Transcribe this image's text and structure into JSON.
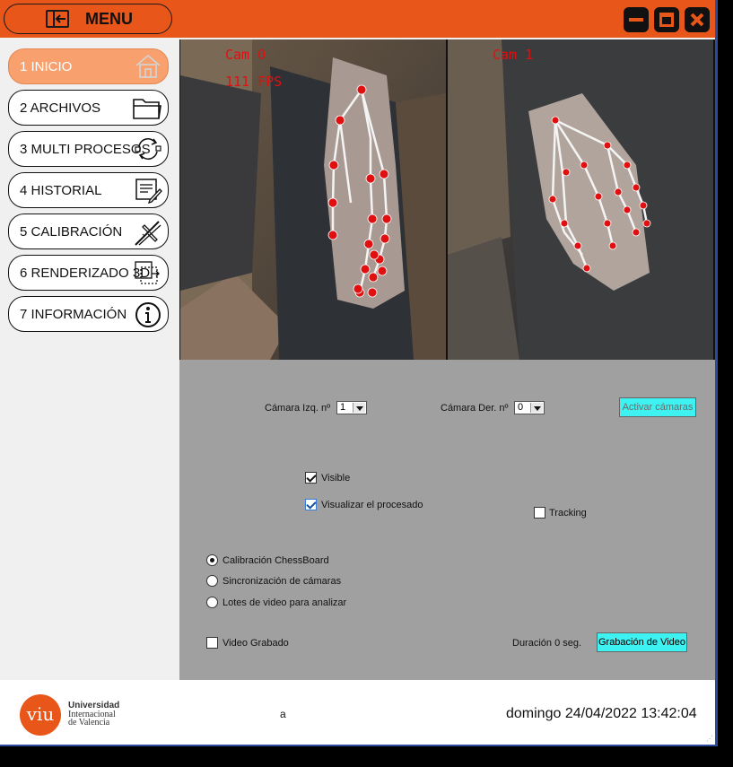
{
  "header": {
    "menu_label": "MENU"
  },
  "window_controls": [
    "minimize-icon",
    "maximize-icon",
    "close-icon"
  ],
  "sidebar": {
    "items": [
      {
        "label": "1 INICIO",
        "icon": "home-icon",
        "active": true
      },
      {
        "label": "2 ARCHIVOS",
        "icon": "folder-icon",
        "active": false
      },
      {
        "label": "3 MULTI PROCESOS",
        "icon": "cycle-icon",
        "active": false
      },
      {
        "label": "4 HISTORIAL",
        "icon": "document-edit-icon",
        "active": false
      },
      {
        "label": "5 CALIBRACIÓN",
        "icon": "caliper-icon",
        "active": false
      },
      {
        "label": "6 RENDERIZADO 3D",
        "icon": "3d-box-icon",
        "active": false
      },
      {
        "label": "7 INFORMACIÓN",
        "icon": "info-icon",
        "active": false
      }
    ]
  },
  "video": {
    "cam0_label": "Cam 0",
    "cam0_fps": "111 FPS",
    "cam1_label": "Cam 1"
  },
  "controls": {
    "left_cam_label": "Cámara Izq. nº",
    "left_cam_value": "1",
    "right_cam_label": "Cámara Der. nº",
    "right_cam_value": "0",
    "activate_label": "Activar cámaras",
    "visible_label": "Visible",
    "visible_checked": true,
    "visualize_label": "Visualizar el procesado",
    "visualize_checked": true,
    "tracking_label": "Tracking",
    "tracking_checked": false,
    "radios": [
      {
        "label": "Calibración ChessBoard",
        "selected": true
      },
      {
        "label": "Sincronización de cámaras",
        "selected": false
      },
      {
        "label": "Lotes de video para analizar",
        "selected": false
      }
    ],
    "recorded_label": "Video Grabado",
    "recorded_checked": false,
    "duration_label": "Duración 0 seg.",
    "record_button": "Grabación de Video"
  },
  "footer": {
    "logo_text": "viu",
    "org_line1": "Universidad",
    "org_line2": "Internacional",
    "org_line3": "de Valencia",
    "center_text": "a",
    "datetime": "domingo 24/04/2022 13:42:04"
  },
  "colors": {
    "accent": "#e8561a",
    "active_nav": "#f8a06e",
    "cyan_button": "#3ff2f2",
    "panel_gray": "#a0a0a0",
    "landmark_red": "#e01010"
  }
}
